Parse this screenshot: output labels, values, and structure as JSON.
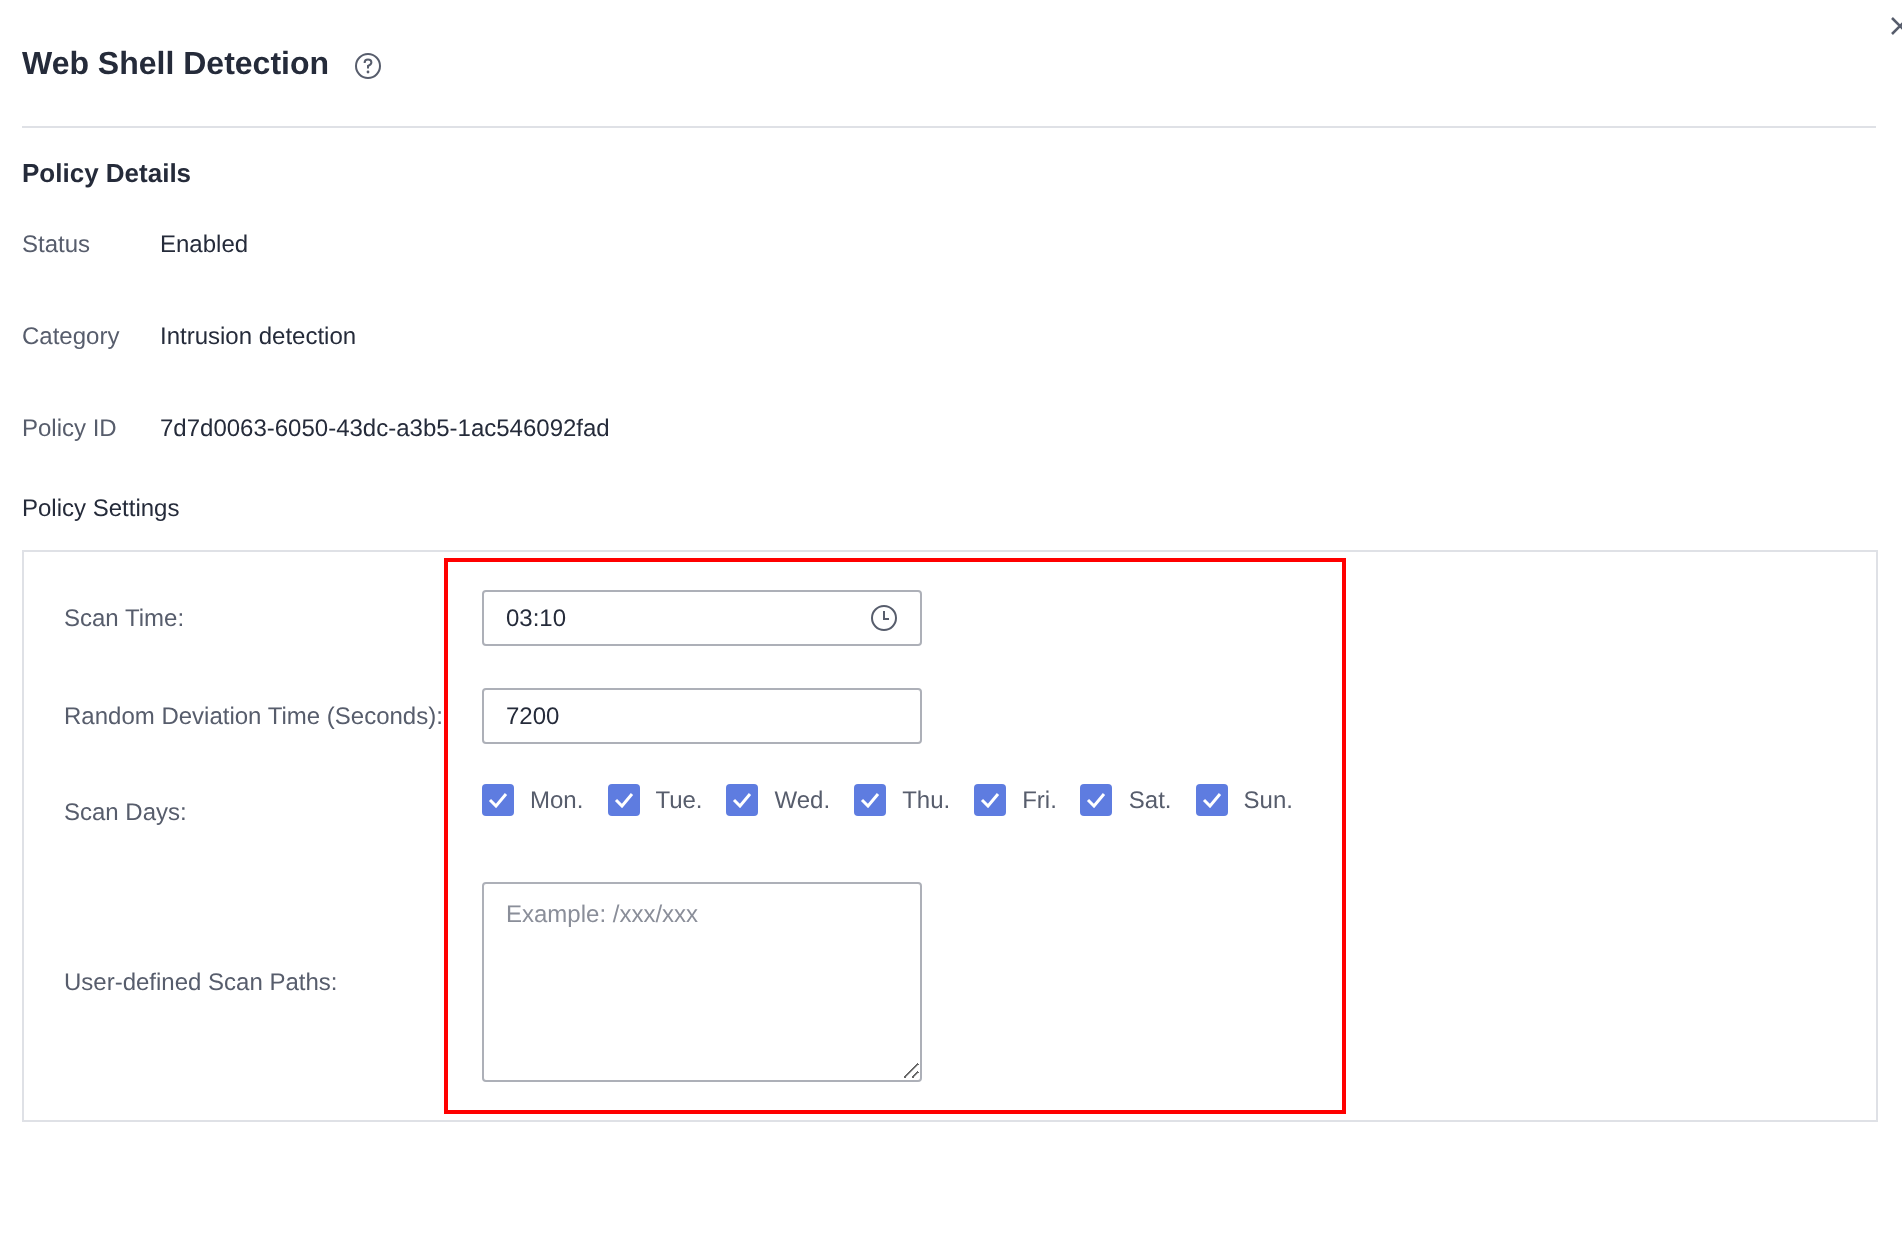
{
  "title": "Web Shell Detection",
  "policy_details": {
    "heading": "Policy Details",
    "fields": [
      {
        "label": "Status",
        "value": "Enabled"
      },
      {
        "label": "Category",
        "value": "Intrusion detection"
      },
      {
        "label": "Policy ID",
        "value": "7d7d0063-6050-43dc-a3b5-1ac546092fad"
      }
    ]
  },
  "policy_settings": {
    "heading": "Policy Settings",
    "scan_time": {
      "label": "Scan Time:",
      "value": "03:10"
    },
    "deviation": {
      "label": "Random Deviation Time (Seconds):",
      "value": "7200"
    },
    "scan_days": {
      "label": "Scan Days:",
      "days": [
        {
          "label": "Mon.",
          "checked": true
        },
        {
          "label": "Tue.",
          "checked": true
        },
        {
          "label": "Wed.",
          "checked": true
        },
        {
          "label": "Thu.",
          "checked": true
        },
        {
          "label": "Fri.",
          "checked": true
        },
        {
          "label": "Sat.",
          "checked": true
        },
        {
          "label": "Sun.",
          "checked": true
        }
      ]
    },
    "scan_paths": {
      "label": "User-defined Scan Paths:",
      "placeholder": "Example: /xxx/xxx"
    }
  }
}
